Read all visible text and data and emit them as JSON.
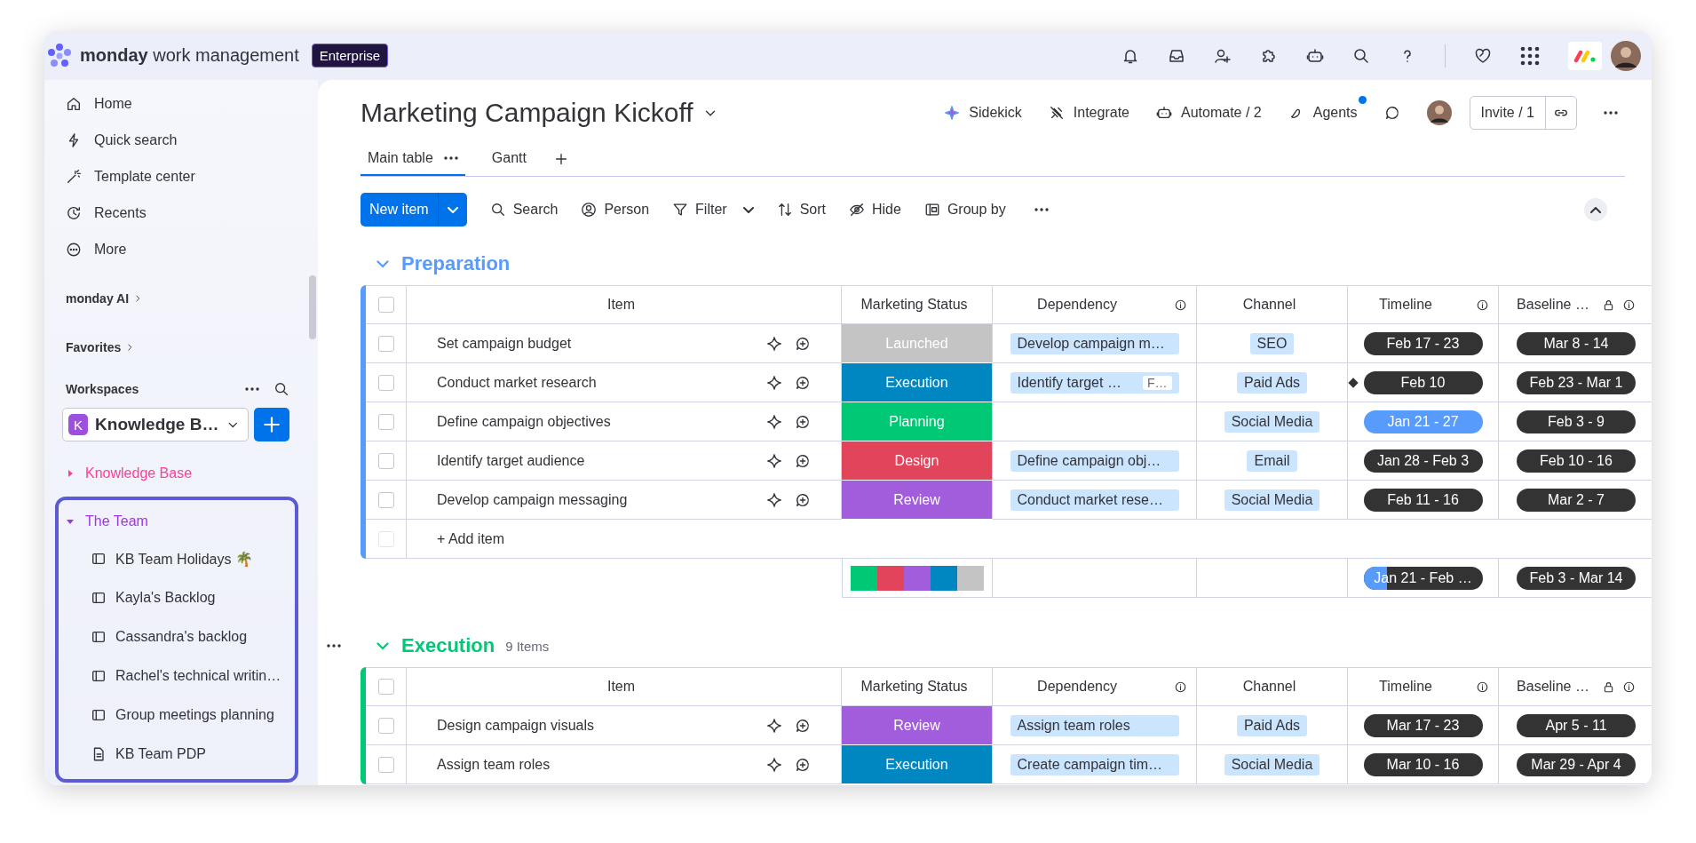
{
  "top_bar": {
    "logo_text": "monday",
    "product": "work management",
    "plan_badge": "Enterprise"
  },
  "sidebar": {
    "nav": [
      {
        "label": "Home"
      },
      {
        "label": "Quick search"
      },
      {
        "label": "Template center"
      },
      {
        "label": "Recents"
      },
      {
        "label": "More"
      }
    ],
    "sections": [
      "monday AI",
      "Favorites"
    ],
    "workspaces_label": "Workspaces",
    "workspace": {
      "initial": "K",
      "name": "Knowledge B…"
    },
    "tree": [
      {
        "label": "Knowledge Base",
        "color": "#ff3d9a",
        "expanded": false,
        "highlighted": false
      },
      {
        "label": "The Team",
        "color": "#9d35e0",
        "expanded": true,
        "highlighted": true,
        "children": [
          {
            "label": "KB Team Holidays 🌴",
            "kind": "board"
          },
          {
            "label": "Kayla's Backlog",
            "kind": "board"
          },
          {
            "label": "Cassandra's backlog",
            "kind": "board"
          },
          {
            "label": "Rachel's technical writin…",
            "kind": "board"
          },
          {
            "label": "Group meetings planning",
            "kind": "board"
          },
          {
            "label": "KB Team PDP",
            "kind": "doc"
          }
        ]
      }
    ]
  },
  "board": {
    "title": "Marketing Campaign Kickoff",
    "actions": [
      {
        "label": "Sidekick",
        "notification": false
      },
      {
        "label": "Integrate",
        "notification": false
      },
      {
        "label": "Automate / 2",
        "notification": false
      },
      {
        "label": "Agents",
        "notification": true
      }
    ],
    "invite": "Invite / 1",
    "tabs": [
      {
        "label": "Main table",
        "selected": true
      },
      {
        "label": "Gantt",
        "selected": false
      }
    ],
    "new_item": "New item",
    "toolbar": [
      {
        "label": "Search",
        "dropdown": false
      },
      {
        "label": "Person",
        "dropdown": false
      },
      {
        "label": "Filter",
        "dropdown": true
      },
      {
        "label": "Sort",
        "dropdown": false
      },
      {
        "label": "Hide",
        "dropdown": false
      },
      {
        "label": "Group by",
        "dropdown": false
      }
    ],
    "groups": [
      {
        "name": "Preparation",
        "color": "#579bfc",
        "expanded": true,
        "menu": false,
        "all_checked": false,
        "columns": [
          {
            "label": "Item",
            "info": false,
            "locked": false
          },
          {
            "label": "Marketing Status",
            "info": false,
            "locked": false
          },
          {
            "label": "Dependency",
            "info": true,
            "locked": false
          },
          {
            "label": "Channel",
            "info": false,
            "locked": false
          },
          {
            "label": "Timeline",
            "info": true,
            "locked": false
          },
          {
            "label": "Baseline …",
            "info": true,
            "locked": true
          }
        ],
        "rows": [
          {
            "checked": false,
            "item": "Set campaign budget",
            "status": {
              "label": "Launched",
              "color": "#c4c4c4"
            },
            "dependency": {
              "text": "Develop campaign m…"
            },
            "channel": "SEO",
            "timeline": {
              "text": "Feb 17 - 23",
              "current": false,
              "milestone": false
            },
            "baseline": "Mar 8 - 14"
          },
          {
            "checked": false,
            "item": "Conduct market research",
            "status": {
              "label": "Execution",
              "color": "#0086c0"
            },
            "dependency": {
              "text": "Identify target …",
              "extra": "F…"
            },
            "channel": "Paid Ads",
            "timeline": {
              "text": "Feb 10",
              "current": false,
              "milestone": true
            },
            "baseline": "Feb 23 - Mar 1"
          },
          {
            "checked": false,
            "item": "Define campaign objectives",
            "status": {
              "label": "Planning",
              "color": "#00c875"
            },
            "channel": "Social Media",
            "timeline": {
              "text": "Jan 21 - 27",
              "current": true,
              "milestone": false
            },
            "baseline": "Feb 3 - 9"
          },
          {
            "checked": false,
            "item": "Identify target audience",
            "status": {
              "label": "Design",
              "color": "#e2445c"
            },
            "dependency": {
              "text": "Define campaign obj…"
            },
            "channel": "Email",
            "timeline": {
              "text": "Jan 28 - Feb 3",
              "current": false,
              "milestone": false
            },
            "baseline": "Feb 10 - 16"
          },
          {
            "checked": false,
            "item": "Develop campaign messaging",
            "status": {
              "label": "Review",
              "color": "#a25ddc"
            },
            "dependency": {
              "text": "Conduct market rese…"
            },
            "channel": "Social Media",
            "timeline": {
              "text": "Feb 11 - 16",
              "current": false,
              "milestone": false
            },
            "baseline": "Mar 2 - 7"
          }
        ],
        "add_row": {
          "label": "+ Add item",
          "disabled": true
        },
        "summary": {
          "status_segments": [
            {
              "color": "#00c875"
            },
            {
              "color": "#e2445c"
            },
            {
              "color": "#a25ddc"
            },
            {
              "color": "#0086c0"
            },
            {
              "color": "#c4c4c4"
            }
          ],
          "timeline": {
            "text": "Jan 21 - Feb …",
            "level": 0.2
          },
          "baseline": "Feb 3 - Mar 14"
        }
      },
      {
        "name": "Execution",
        "color": "#00c875",
        "count": "9 Items",
        "expanded": true,
        "menu": true,
        "all_checked": false,
        "columns": [
          {
            "label": "Item",
            "info": false,
            "locked": false
          },
          {
            "label": "Marketing Status",
            "info": false,
            "locked": false
          },
          {
            "label": "Dependency",
            "info": true,
            "locked": false
          },
          {
            "label": "Channel",
            "info": false,
            "locked": false
          },
          {
            "label": "Timeline",
            "info": true,
            "locked": false
          },
          {
            "label": "Baseline …",
            "info": true,
            "locked": true
          }
        ],
        "rows": [
          {
            "checked": false,
            "item": "Design campaign visuals",
            "status": {
              "label": "Review",
              "color": "#a25ddc"
            },
            "dependency": {
              "text": "Assign team roles"
            },
            "channel": "Paid Ads",
            "timeline": {
              "text": "Mar 17 - 23",
              "current": false,
              "milestone": false
            },
            "baseline": "Apr 5 - 11"
          },
          {
            "checked": false,
            "item": "Assign team roles",
            "status": {
              "label": "Execution",
              "color": "#0086c0"
            },
            "dependency": {
              "text": "Create campaign tim…"
            },
            "channel": "Social Media",
            "timeline": {
              "text": "Mar 10 - 16",
              "current": false,
              "milestone": false
            },
            "baseline": "Mar 29 - Apr 4"
          }
        ]
      }
    ]
  }
}
